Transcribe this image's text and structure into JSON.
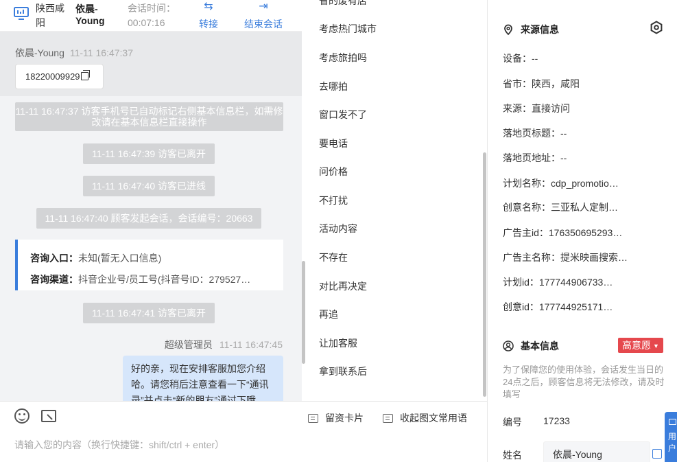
{
  "header": {
    "location": "陕西咸阳",
    "visitor_name": "依晨-Young",
    "session_time_label": "会话时间：",
    "session_time_value": "00:07:16",
    "transfer_label": "转接",
    "end_session_label": "结束会话"
  },
  "chat": {
    "visitor_sender": "依晨-Young",
    "visitor_time": "11-11 16:47:37",
    "phone_number": "18220009929",
    "system_messages": [
      "11-11 16:47:37 访客手机号已自动标记右侧基本信息栏，如需修改请在基本信息栏直接操作",
      "11-11 16:47:39 访客已离开",
      "11-11 16:47:40 访客已进线",
      "11-11 16:47:40 顾客发起会话，会话编号：20663",
      "11-11 16:47:41 访客已离开"
    ],
    "consult_entry_label": "咨询入口：",
    "consult_entry_value": "未知(暂无入口信息)",
    "consult_channel_label": "咨询渠道：",
    "consult_channel_value": "抖音企业号/员工号(抖音号ID：279527…",
    "agent_sender": "超级管理员",
    "agent_time": "11-11 16:47:45",
    "agent_message": "好的亲，现在安排客服加您介绍哈。请您稍后注意查看一下“通讯录”并点击“新的朋友”通过下哦"
  },
  "composer": {
    "placeholder": "请输入您的内容（换行快捷键：shift/ctrl + enter）",
    "leave_card_label": "留资卡片",
    "collapse_label": "收起图文常用语"
  },
  "quick_replies": [
    "省的废有店",
    "考虑热门城市",
    "考虑旅拍吗",
    "去哪拍",
    "窗口发不了",
    "要电话",
    "问价格",
    "不打扰",
    "活动内容",
    "不存在",
    "对比再决定",
    "再追",
    "让加客服",
    "拿到联系后"
  ],
  "source_info": {
    "title": "来源信息",
    "rows": [
      "设备：--",
      "省市：陕西，咸阳",
      "来源：直接访问",
      "落地页标题：--",
      "落地页地址：--",
      "计划名称：cdp_promotio…",
      "创意名称：三亚私人定制…",
      "广告主id：176350695293…",
      "广告主名称：提米映画搜索…",
      "计划id：177744906733…",
      "创意id：177744925171…"
    ]
  },
  "basic_info": {
    "title": "基本信息",
    "intent_badge": "高意愿",
    "note": "为了保障您的使用体验，会话发生当日的24点之后，顾客信息将无法修改，请及时填写",
    "id_label": "编号",
    "id_value": "17233",
    "name_label": "姓名",
    "name_value": "依晨-Young"
  },
  "float_tab_label": "用户"
}
